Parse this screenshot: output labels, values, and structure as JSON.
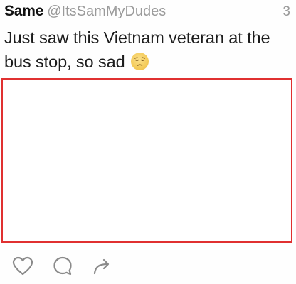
{
  "tweet": {
    "display_name": "Same",
    "handle": "@ItsSamMyDudes",
    "timestamp": "3",
    "text": "Just saw this Vietnam veteran at the bus stop, so sad",
    "emoji": "pensive-face-emoji"
  },
  "media": {
    "border_color": "#e03030"
  },
  "actions": [
    {
      "icon": "heart-icon"
    },
    {
      "icon": "reply-icon"
    },
    {
      "icon": "share-arrow-icon"
    }
  ],
  "colors": {
    "secondary_text": "#9a9a9a",
    "icon": "#8a8a8a"
  }
}
